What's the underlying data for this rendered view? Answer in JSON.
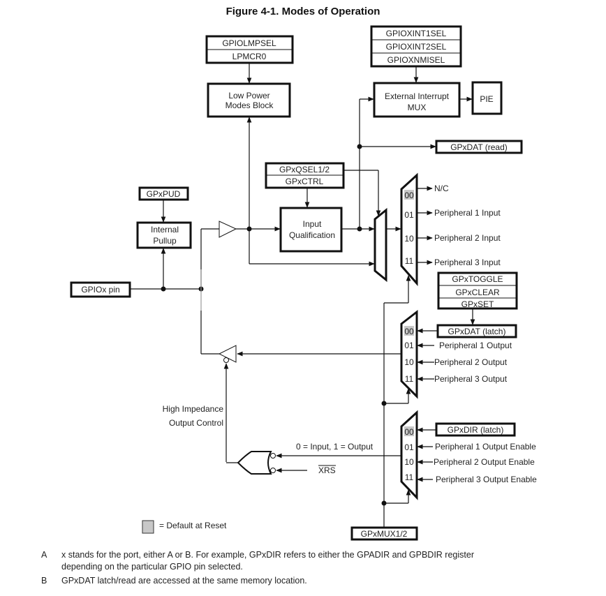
{
  "figure": {
    "title": "Figure 4-1. Modes of Operation"
  },
  "registers": {
    "lpm": [
      "GPIOLMPSEL",
      "LPMCR0"
    ],
    "xint": [
      "GPIOXINT1SEL",
      "GPIOXINT2SEL",
      "GPIOXNMISEL"
    ],
    "qsel": [
      "GPxQSEL1/2",
      "GPxCTRL"
    ],
    "pud": "GPxPUD",
    "pin": "GPIOx pin",
    "dat_read": "GPxDAT (read)",
    "set_clear": [
      "GPxTOGGLE",
      "GPxCLEAR",
      "GPxSET"
    ],
    "dat_latch": "GPxDAT (latch)",
    "dir_latch": "GPxDIR (latch)",
    "mux_sel": "GPxMUX1/2"
  },
  "blocks": {
    "low_power": [
      "Low Power",
      "Modes Block"
    ],
    "ext_int": [
      "External Interrupt",
      "MUX"
    ],
    "pie": "PIE",
    "pullup": [
      "Internal",
      "Pullup"
    ],
    "qual": [
      "Input",
      "Qualification"
    ]
  },
  "input_mux": {
    "codes": [
      "00",
      "01",
      "10",
      "11"
    ],
    "outputs": [
      "N/C",
      "Peripheral 1 Input",
      "Peripheral 2 Input",
      "Peripheral 3 Input"
    ],
    "default_code": "00"
  },
  "output_mux": {
    "codes": [
      "00",
      "01",
      "10",
      "11"
    ],
    "inputs": [
      "GPxDAT (latch)",
      "Peripheral 1 Output",
      "Peripheral 2 Output",
      "Peripheral 3 Output"
    ],
    "default_code": "00"
  },
  "dir_mux": {
    "codes": [
      "00",
      "01",
      "10",
      "11"
    ],
    "inputs": [
      "GPxDIR (latch)",
      "Peripheral 1 Output Enable",
      "Peripheral 2 Output Enable",
      "Peripheral 3 Output Enable"
    ],
    "default_code": "00"
  },
  "labels": {
    "hiz": [
      "High Impedance",
      "Output Control"
    ],
    "dir_signal": "0 = Input, 1 = Output",
    "xrs": "XRS",
    "legend": "= Default at Reset"
  },
  "colors": {
    "default_highlight": "#c8c8c8"
  },
  "notes": [
    {
      "key": "A",
      "text": "x stands for the port, either A or B. For example, GPxDIR refers to either the GPADIR and GPBDIR register",
      "text2": "depending on the particular GPIO pin selected."
    },
    {
      "key": "B",
      "text": "GPxDAT latch/read are accessed at the same memory location."
    }
  ]
}
